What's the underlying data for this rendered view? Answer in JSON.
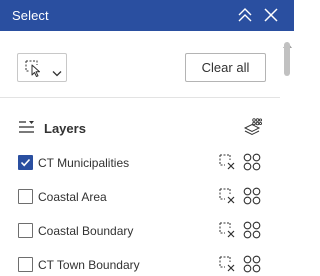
{
  "header": {
    "title": "Select",
    "background": "#2a4fa0"
  },
  "toolbar": {
    "select_tool_icon": "pointer-selection-icon",
    "clear_all_label": "Clear all"
  },
  "layers": {
    "title": "Layers",
    "items": [
      {
        "label": "CT Municipalities",
        "checked": true
      },
      {
        "label": "Coastal Area",
        "checked": false
      },
      {
        "label": "Coastal Boundary",
        "checked": false
      },
      {
        "label": "CT Town Boundary",
        "checked": false
      }
    ]
  },
  "colors": {
    "accent": "#2a4fa0",
    "text": "#323232",
    "border": "#c8c8c8"
  }
}
